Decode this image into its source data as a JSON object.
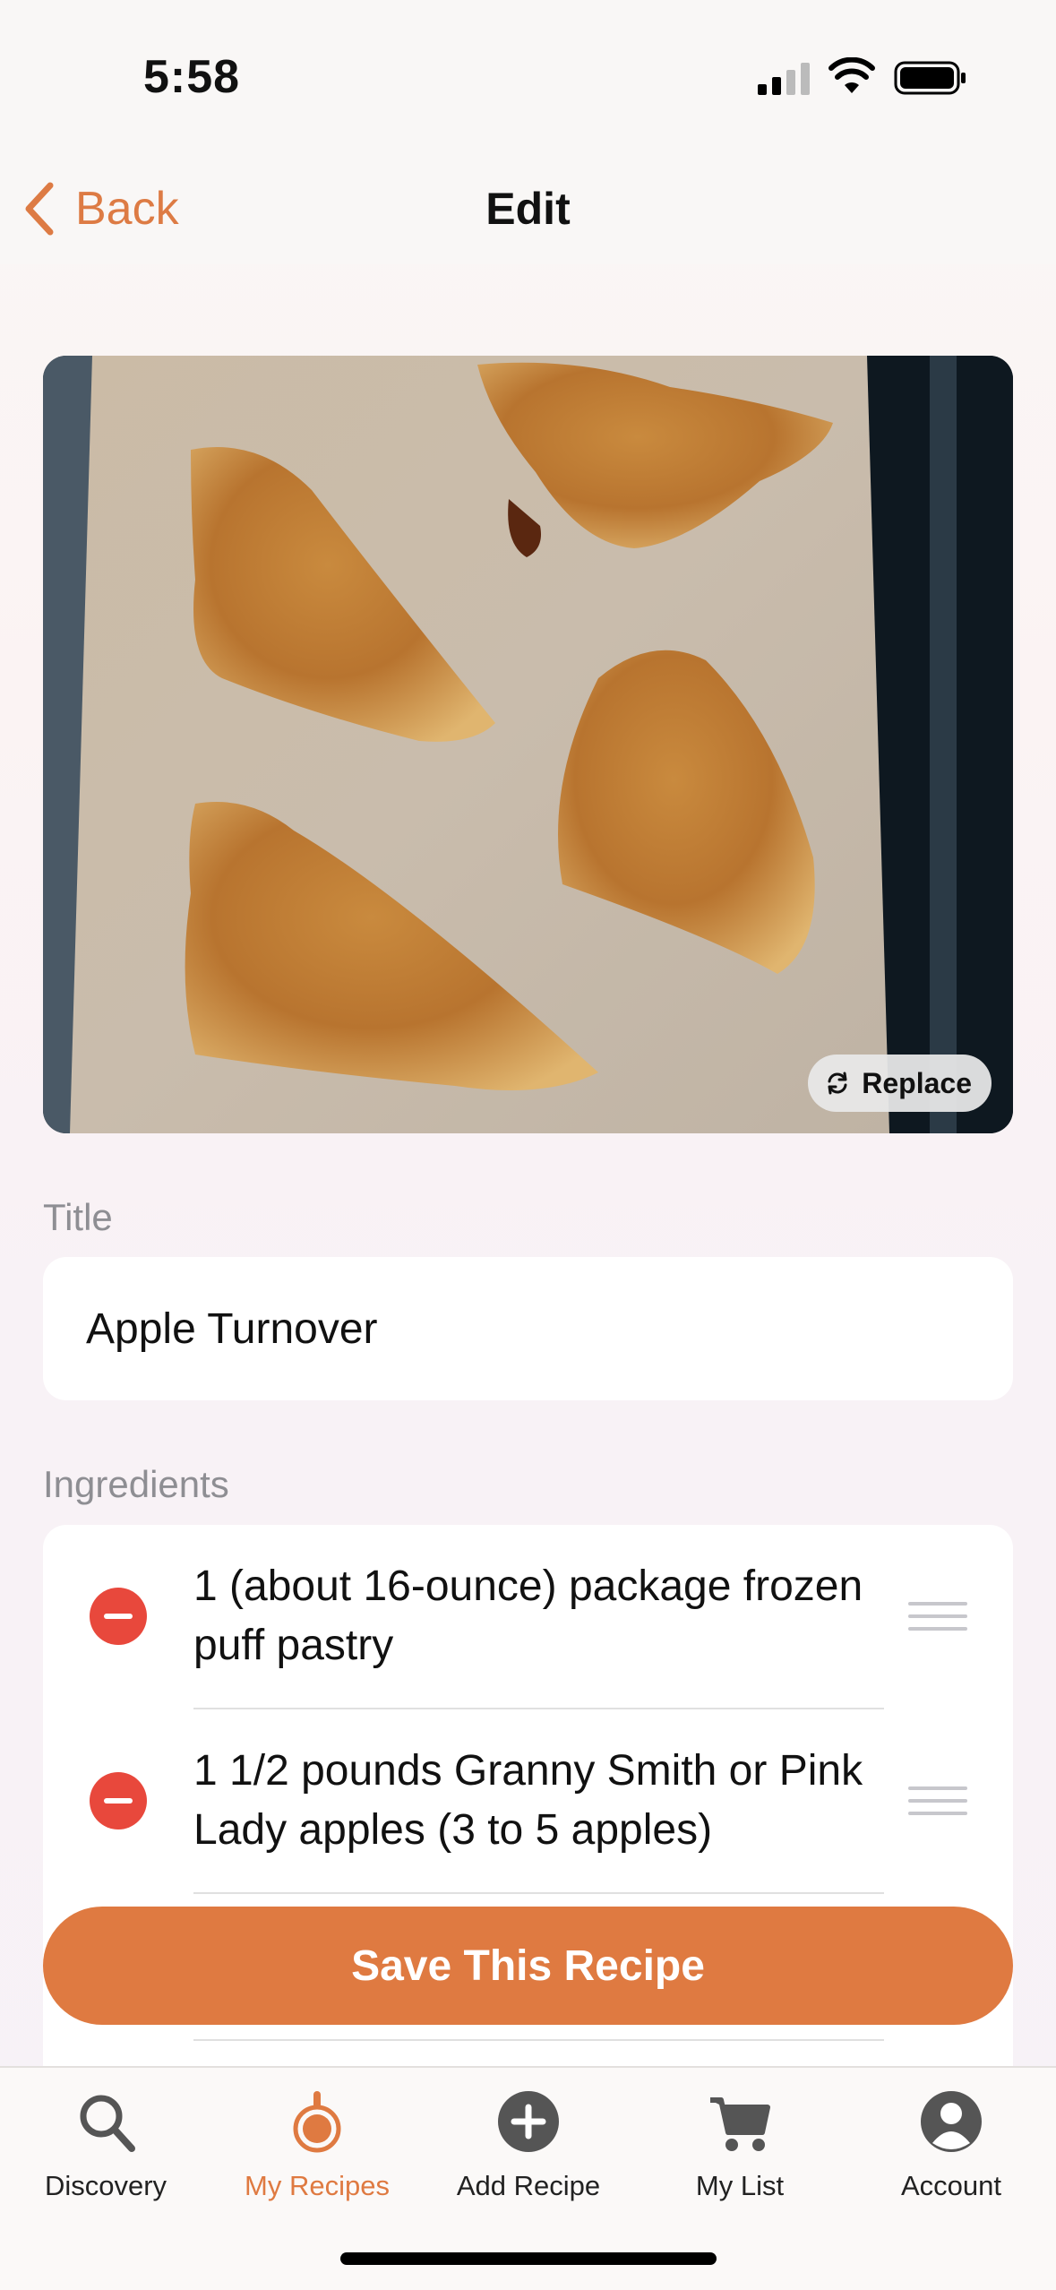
{
  "status_bar": {
    "time": "5:58"
  },
  "nav": {
    "back_label": "Back",
    "title": "Edit"
  },
  "photo": {
    "replace_label": "Replace"
  },
  "form": {
    "title_label": "Title",
    "title_value": "Apple Turnover",
    "ingredients_label": "Ingredients",
    "ingredients": [
      "1 (about 16-ounce) package frozen puff pastry",
      "1 1/2 pounds Granny Smith or Pink Lady apples (3 to 5 apples)"
    ]
  },
  "save_button_label": "Save This Recipe",
  "tab_bar": {
    "items": [
      {
        "label": "Discovery",
        "icon": "search-icon"
      },
      {
        "label": "My Recipes",
        "icon": "pan-icon",
        "active": true
      },
      {
        "label": "Add Recipe",
        "icon": "plus-circle-icon"
      },
      {
        "label": "My List",
        "icon": "cart-icon"
      },
      {
        "label": "Account",
        "icon": "person-circle-icon"
      }
    ]
  },
  "colors": {
    "accent": "#df7a41",
    "remove": "#e8483c"
  }
}
